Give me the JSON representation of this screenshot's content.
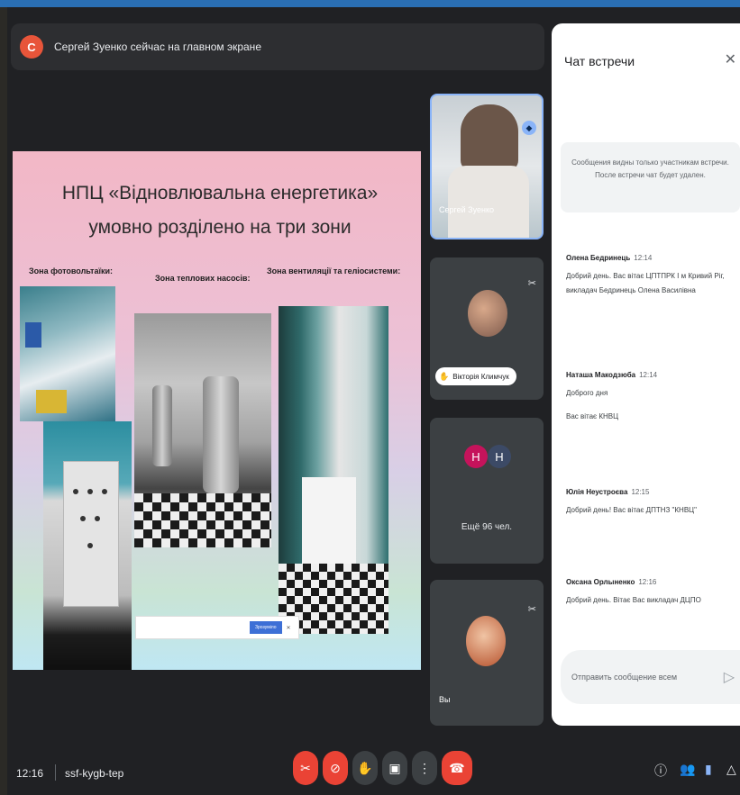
{
  "banner": {
    "avatar_letter": "С",
    "text": "Сергей Зуенко сейчас на главном экране"
  },
  "slide": {
    "title": "НПЦ «Відновлювальна енергетика» умовно розділено на три зони",
    "zones": [
      "Зона фотовольтаїки:",
      "Зона теплових насосів:",
      "Зона вентиляції та геліосистеми:"
    ],
    "cookie_accept": "Зрозуміло"
  },
  "tiles": {
    "speaker_name": "Сергей Зуенко",
    "participant2_name": "Вікторія Климчук",
    "avatar1": "Н",
    "avatar2": "Н",
    "more_label": "Ещё 96 чел.",
    "self_label": "Вы"
  },
  "chat": {
    "title": "Чат встречи",
    "note": "Сообщения видны только участникам встречи. После встречи чат будет удален.",
    "messages": [
      {
        "author": "Олена Бедринець",
        "time": "12:14",
        "lines": [
          "Добрий день. Вас вітає ЦПТПРК І м Кривий Ріг, викладач Бедринець Олена Василівна"
        ]
      },
      {
        "author": "Наташа Макодзюба",
        "time": "12:14",
        "lines": [
          "Доброго дня",
          "Вас вітає КНВЦ"
        ]
      },
      {
        "author": "Юлія Неустроєва",
        "time": "12:15",
        "lines": [
          "Добрий день! Вас вітає ДПТНЗ \"КНВЦ\""
        ]
      },
      {
        "author": "Оксана Орлыненко",
        "time": "12:16",
        "lines": [
          "Добрий день. Вітає Вас викладач ДЦПО"
        ]
      }
    ],
    "input_placeholder": "Отправить сообщение всем"
  },
  "bottom": {
    "time": "12:16",
    "meeting_code": "ssf-kygb-tep"
  },
  "icons": {
    "close": "close-icon",
    "send": "send-icon",
    "mic_off": "mic-off-icon",
    "cam_off": "camera-off-icon",
    "hand": "raise-hand-icon",
    "present": "present-screen-icon",
    "more": "more-vert-icon",
    "end_call": "end-call-icon",
    "info": "info-icon",
    "people": "people-icon",
    "chat": "chat-icon",
    "activities": "activities-icon"
  },
  "colors": {
    "meet_bg": "#202124",
    "end_call": "#ea4335",
    "active_border": "#8ab4f8"
  }
}
